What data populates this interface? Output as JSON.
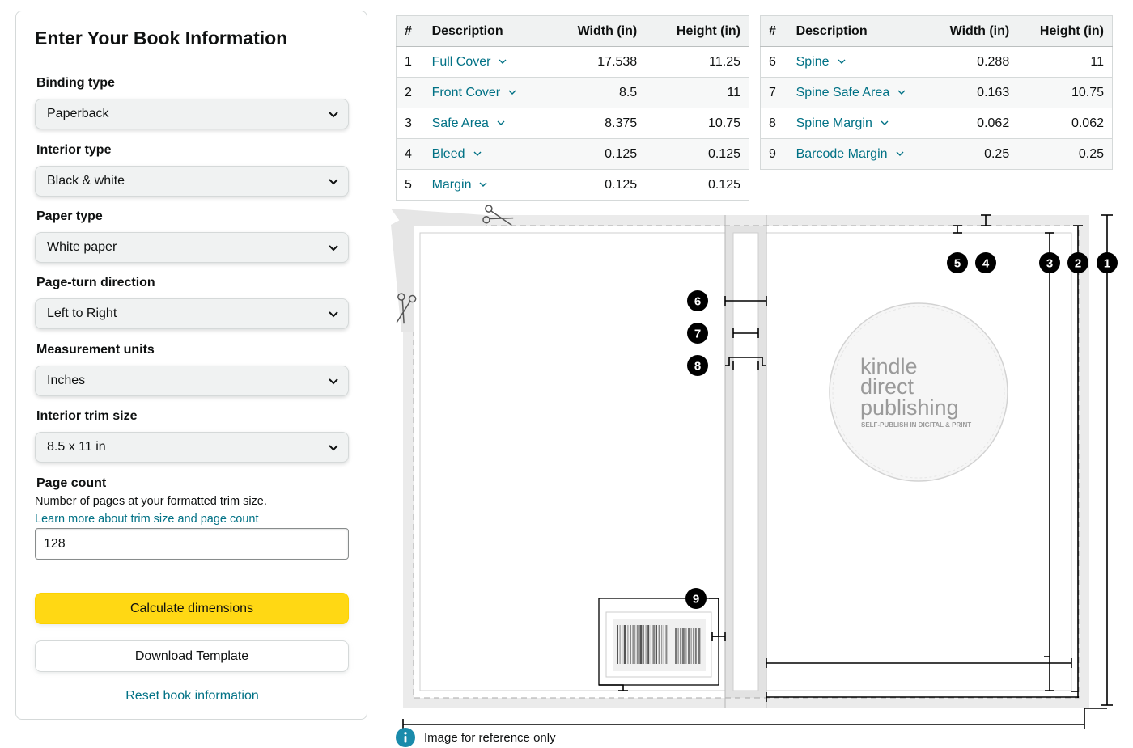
{
  "form": {
    "title": "Enter Your Book Information",
    "binding": {
      "label": "Binding type",
      "value": "Paperback"
    },
    "interior": {
      "label": "Interior type",
      "value": "Black & white"
    },
    "paper": {
      "label": "Paper type",
      "value": "White paper"
    },
    "direction": {
      "label": "Page-turn direction",
      "value": "Left to Right"
    },
    "units": {
      "label": "Measurement units",
      "value": "Inches"
    },
    "trim": {
      "label": "Interior trim size",
      "value": "8.5 x 11 in"
    },
    "page_count": {
      "label": "Page count",
      "help": "Number of pages at your formatted trim size.",
      "link": "Learn more about trim size and page count",
      "value": "128"
    },
    "calculate_label": "Calculate dimensions",
    "download_label": "Download Template",
    "reset_label": "Reset book information"
  },
  "table_headers": {
    "num": "#",
    "desc": "Description",
    "width": "Width (in)",
    "height": "Height (in)"
  },
  "table1": [
    {
      "num": "1",
      "desc": "Full Cover",
      "width": "17.538",
      "height": "11.25"
    },
    {
      "num": "2",
      "desc": "Front Cover",
      "width": "8.5",
      "height": "11"
    },
    {
      "num": "3",
      "desc": "Safe Area",
      "width": "8.375",
      "height": "10.75"
    },
    {
      "num": "4",
      "desc": "Bleed",
      "width": "0.125",
      "height": "0.125"
    },
    {
      "num": "5",
      "desc": "Margin",
      "width": "0.125",
      "height": "0.125"
    }
  ],
  "table2": [
    {
      "num": "6",
      "desc": "Spine",
      "width": "0.288",
      "height": "11"
    },
    {
      "num": "7",
      "desc": "Spine Safe Area",
      "width": "0.163",
      "height": "10.75"
    },
    {
      "num": "8",
      "desc": "Spine Margin",
      "width": "0.062",
      "height": "0.062"
    },
    {
      "num": "9",
      "desc": "Barcode Margin",
      "width": "0.25",
      "height": "0.25"
    }
  ],
  "diagram": {
    "callouts": [
      "1",
      "2",
      "3",
      "4",
      "5",
      "6",
      "7",
      "8",
      "9"
    ],
    "logo": {
      "line1": "kindle",
      "line2": "direct",
      "line3": "publishing",
      "tagline": "SELF-PUBLISH IN DIGITAL & PRINT"
    }
  },
  "note": "Image for reference only",
  "icons": [
    "chevron-down-icon",
    "scissors-icon",
    "info-icon"
  ],
  "colors": {
    "link": "#007185",
    "primary_button": "#ffd814",
    "info": "#1a8bab"
  }
}
